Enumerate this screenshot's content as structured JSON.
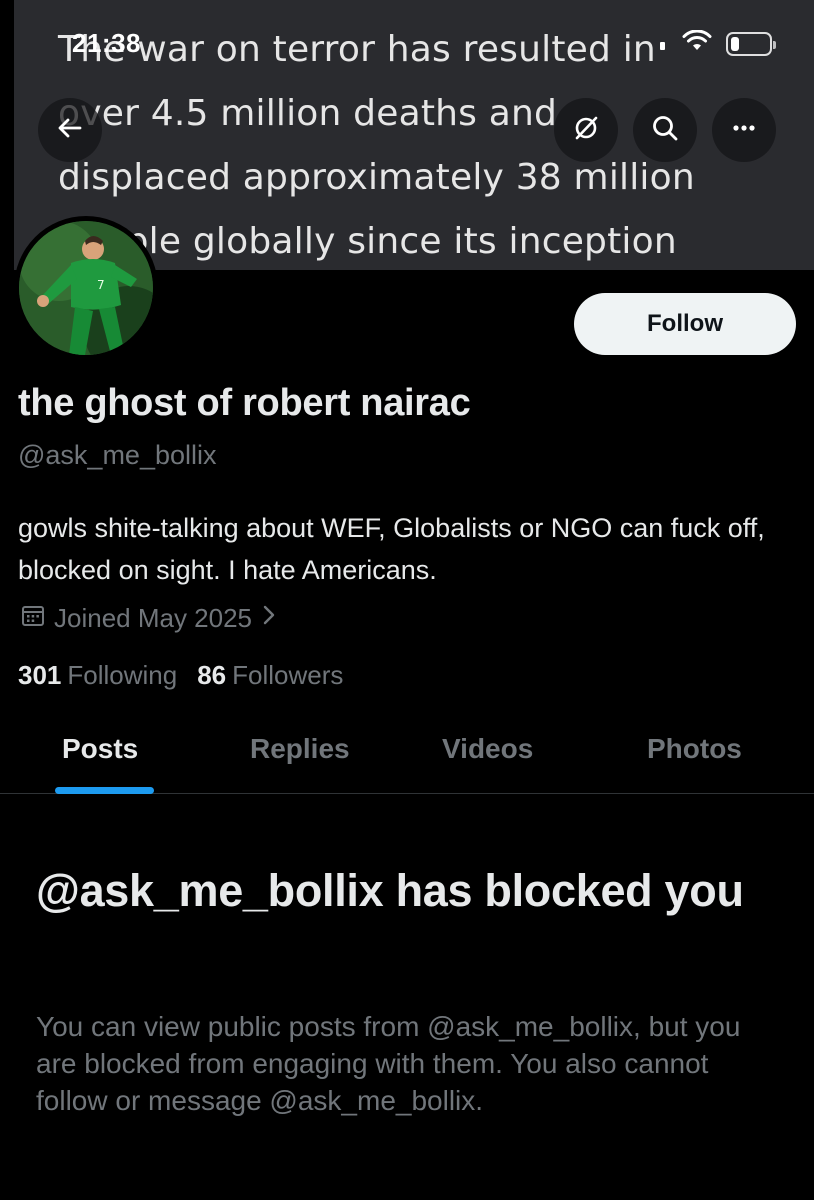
{
  "status_bar": {
    "time": "21:38",
    "battery_percent": 20
  },
  "banner": {
    "lines": [
      "The war on terror has resulted in",
      "over 4.5 million deaths and",
      "displaced approximately 38 million",
      "people globally since its inception"
    ]
  },
  "header": {
    "back_icon": "arrow-left-icon",
    "grok_icon": "grok-icon",
    "search_icon": "search-icon",
    "more_icon": "more-icon"
  },
  "profile": {
    "display_name": "the ghost of robert nairac",
    "handle": "@ask_me_bollix",
    "bio": "gowls shite-talking about WEF, Globalists or NGO can fuck off, blocked on sight. I hate Americans.",
    "joined": "Joined May 2025",
    "following_count": "301",
    "following_label": "Following",
    "followers_count": "86",
    "followers_label": "Followers",
    "follow_label": "Follow"
  },
  "tabs": [
    {
      "label": "Posts",
      "active": true
    },
    {
      "label": "Replies",
      "active": false
    },
    {
      "label": "Videos",
      "active": false
    },
    {
      "label": "Photos",
      "active": false
    }
  ],
  "blocked": {
    "title": "@ask_me_bollix has blocked you",
    "description": "You can view public posts from @ask_me_bollix, but you are blocked from engaging with them. You also cannot follow or message @ask_me_bollix."
  },
  "colors": {
    "background": "#000000",
    "accent": "#1d9bf0",
    "secondary_text": "#71767b",
    "primary_text": "#e7e9ea",
    "follow_button_bg": "#eff3f4"
  }
}
